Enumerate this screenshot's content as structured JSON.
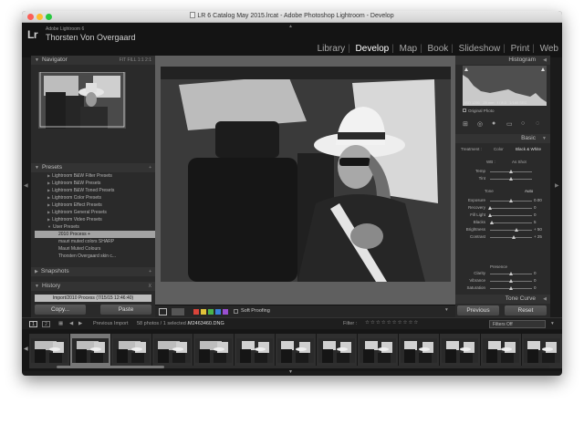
{
  "window": {
    "title": "LR 6 Catalog May 2015.lrcat - Adobe Photoshop Lightroom - Develop"
  },
  "identity": {
    "logo": "Lr",
    "version": "Adobe Lightroom 6",
    "user": "Thorsten Von Overgaard"
  },
  "modules": {
    "items": [
      "Library",
      "Develop",
      "Map",
      "Book",
      "Slideshow",
      "Print",
      "Web"
    ],
    "active": "Develop"
  },
  "left_panel": {
    "navigator_label": "Navigator",
    "navigator_zoom": [
      "FIT",
      "FILL",
      "1:1",
      "2:1"
    ],
    "presets_label": "Presets",
    "presets_ctrl": "+",
    "presets": [
      "Lightroom B&W Filter Presets",
      "Lightroom B&W Presets",
      "Lightroom B&W Toned Presets",
      "Lightroom Color Presets",
      "Lightroom Effect Presets",
      "Lightroom General Presets",
      "Lightroom Video Presets",
      "User Presets"
    ],
    "user_presets": [
      "2010 Process",
      "mauri muted colors SHARP",
      "Mauri Muted Colours",
      "Thorsten Overgaard skin c..."
    ],
    "snapshots_label": "Snapshots",
    "history_label": "History",
    "history_ctrl": "X",
    "history_item": "Import/2010 Process (7/15/15 12:46:40)",
    "copy_label": "Copy...",
    "paste_label": "Paste"
  },
  "toolbar": {
    "soft_proofing": "Soft Proofing",
    "flag_colors": [
      "#d9443a",
      "#e0c23a",
      "#4bb34b",
      "#3a7fd9",
      "#9a4fd1"
    ]
  },
  "right_panel": {
    "histogram_label": "Histogram",
    "hist_info": [
      "ISO 1250",
      "28 mm",
      "f / 8.0",
      "1/160 SEC"
    ],
    "original_photo": "Original Photo",
    "basic_label": "Basic",
    "treatment_label": "Treatment :",
    "treatment_color": "Color",
    "treatment_bw": "Black & White",
    "wb_label": "WB :",
    "wb_value": "As Shot",
    "tone_label": "Tone",
    "tone_auto": "Auto",
    "presence_label": "Presence",
    "sliders_wb": [
      {
        "label": "Temp",
        "value": "",
        "pos": 0.5
      },
      {
        "label": "Tint",
        "value": "",
        "pos": 0.5
      }
    ],
    "sliders_tone": [
      {
        "label": "Exposure",
        "value": "0.00",
        "pos": 0.5
      },
      {
        "label": "Recovery",
        "value": "0",
        "pos": 0.0
      },
      {
        "label": "Fill Light",
        "value": "0",
        "pos": 0.0
      },
      {
        "label": "Blacks",
        "value": "5",
        "pos": 0.05
      },
      {
        "label": "Brightness",
        "value": "+ 50",
        "pos": 0.62
      },
      {
        "label": "Contrast",
        "value": "+ 25",
        "pos": 0.56
      }
    ],
    "sliders_presence": [
      {
        "label": "Clarity",
        "value": "0",
        "pos": 0.5
      },
      {
        "label": "Vibrance",
        "value": "0",
        "pos": 0.5
      },
      {
        "label": "Saturation",
        "value": "0",
        "pos": 0.5
      }
    ],
    "tone_curve_label": "Tone Curve",
    "previous_label": "Previous",
    "reset_label": "Reset"
  },
  "filmbar": {
    "page1": "1",
    "page2": "2",
    "source": "Previous Import",
    "count": "58 photos / 1 selected /",
    "filename": "M2463460.DNG",
    "filter_label": "Filter :",
    "filters_value": "Filters Off"
  },
  "filmstrip": {
    "count": 13,
    "selected_index": 1
  }
}
